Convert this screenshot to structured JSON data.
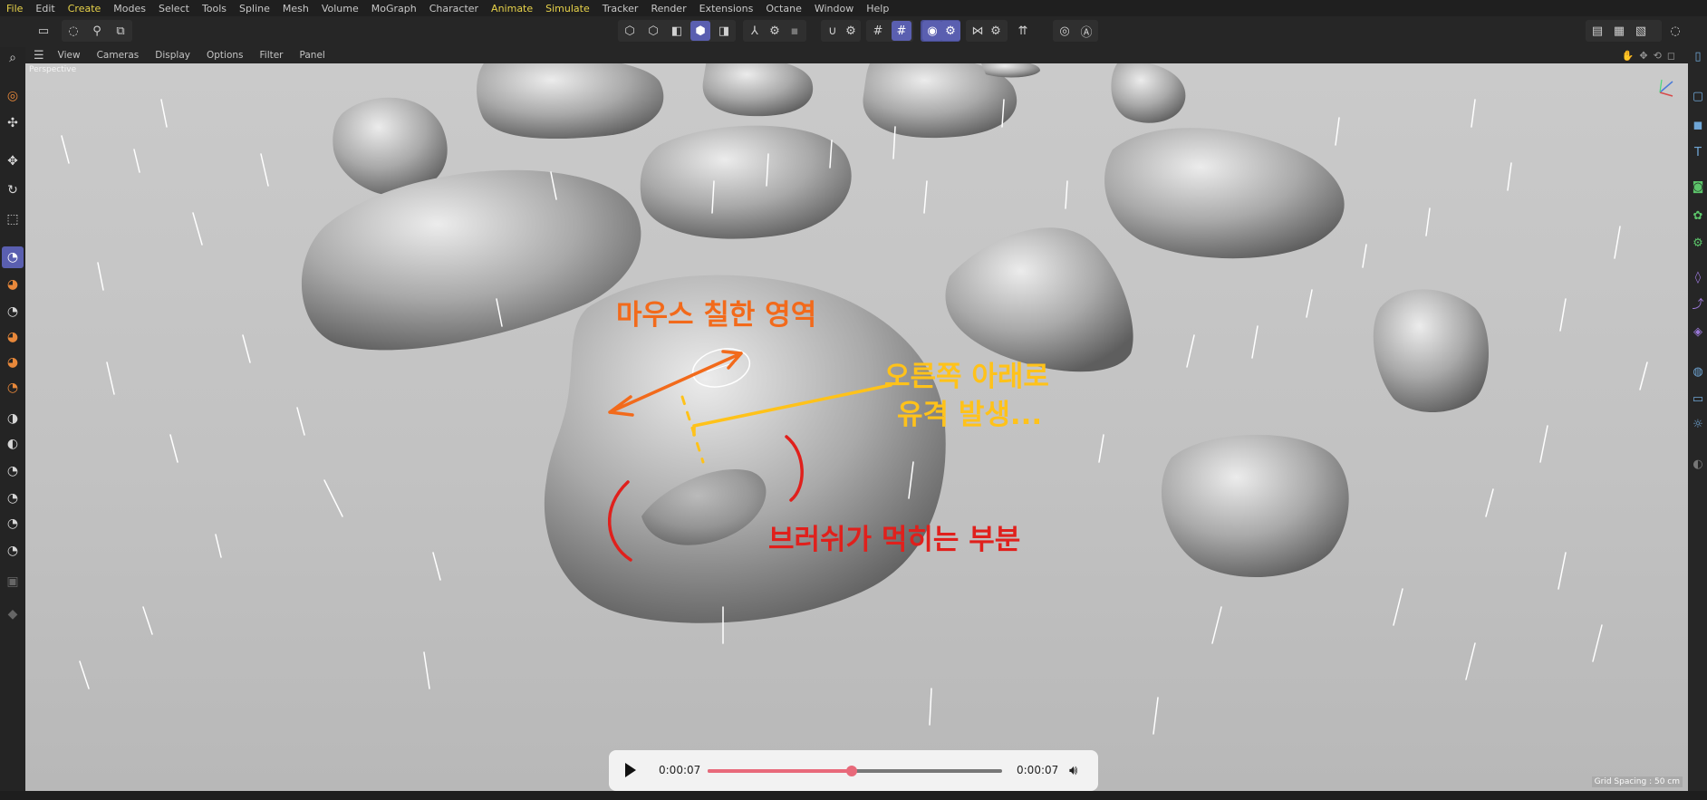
{
  "menu": [
    "File",
    "Edit",
    "Create",
    "Modes",
    "Select",
    "Tools",
    "Spline",
    "Mesh",
    "Volume",
    "MoGraph",
    "Character",
    "Animate",
    "Simulate",
    "Tracker",
    "Render",
    "Extensions",
    "Octane",
    "Window",
    "Help"
  ],
  "viewport_menu": [
    "View",
    "Cameras",
    "Display",
    "Options",
    "Filter",
    "Panel"
  ],
  "viewport": {
    "camera_label": "Perspective",
    "grid_spacing": "Grid Spacing : 50 cm"
  },
  "annotations": {
    "mouse_area": "마우스 칠한 영역",
    "lower_right_line1": "오른쪽 아래로",
    "lower_right_line2": "유격 발생...",
    "brush_blocked": "브러쉬가 먹히는 부분"
  },
  "player": {
    "current_time": "0:00:07",
    "duration": "0:00:07",
    "progress": 0.49
  },
  "colors": {
    "accent": "#5a5fb0",
    "annotation_orange": "#f26a1b",
    "annotation_yellow": "#ffc21a",
    "annotation_red": "#e0201c",
    "player_progress": "#e8697a"
  }
}
